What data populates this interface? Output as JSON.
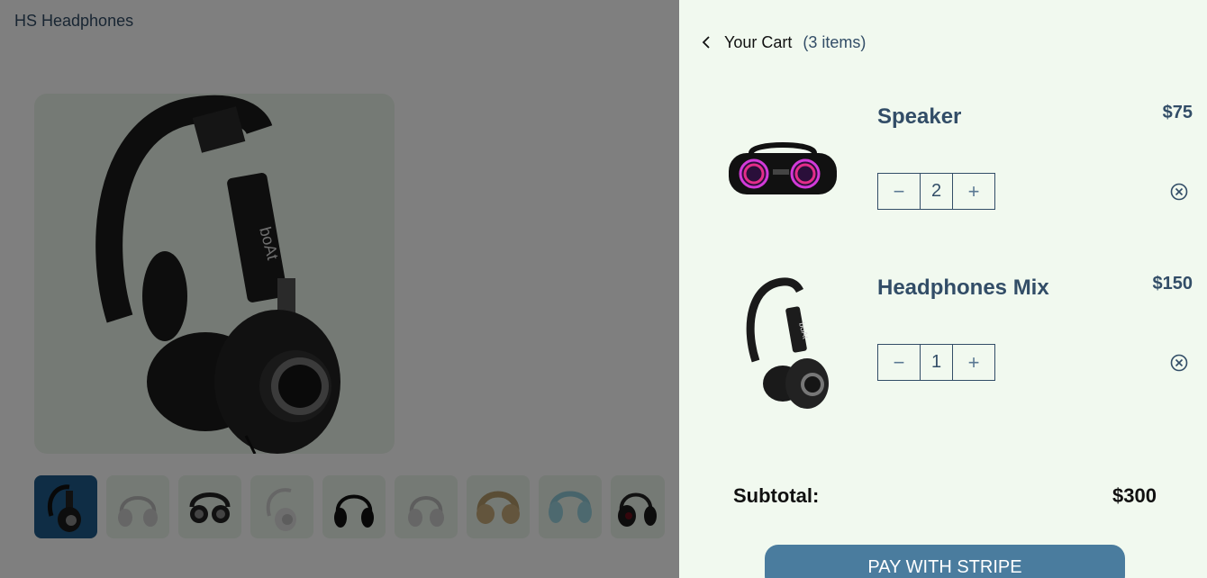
{
  "header": {
    "brand": "HS Headphones"
  },
  "product": {
    "main_image": "headphones-black",
    "thumbnails": [
      "headphones-black",
      "headphones-white",
      "headphones-folded-black",
      "headphones-white-side",
      "headphones-black-front",
      "headphones-grey",
      "headphones-beige",
      "headphones-blue",
      "headphones-dark-red"
    ]
  },
  "cart": {
    "title": "Your Cart",
    "count_label": "(3 items)",
    "items": [
      {
        "name": "Speaker",
        "price": "$75",
        "quantity": "2",
        "image": "speaker-icon"
      },
      {
        "name": "Headphones Mix",
        "price": "$150",
        "quantity": "1",
        "image": "headphones-icon"
      }
    ],
    "qty_minus": "−",
    "qty_plus": "+",
    "subtotal_label": "Subtotal:",
    "subtotal_value": "$300",
    "pay_button": "PAY WITH STRIPE"
  },
  "colors": {
    "accent": "#324d67",
    "pay_button": "#4a7c9e",
    "panel_bg": "#f1f9ef",
    "thumb_bg": "#ebf5ea"
  }
}
